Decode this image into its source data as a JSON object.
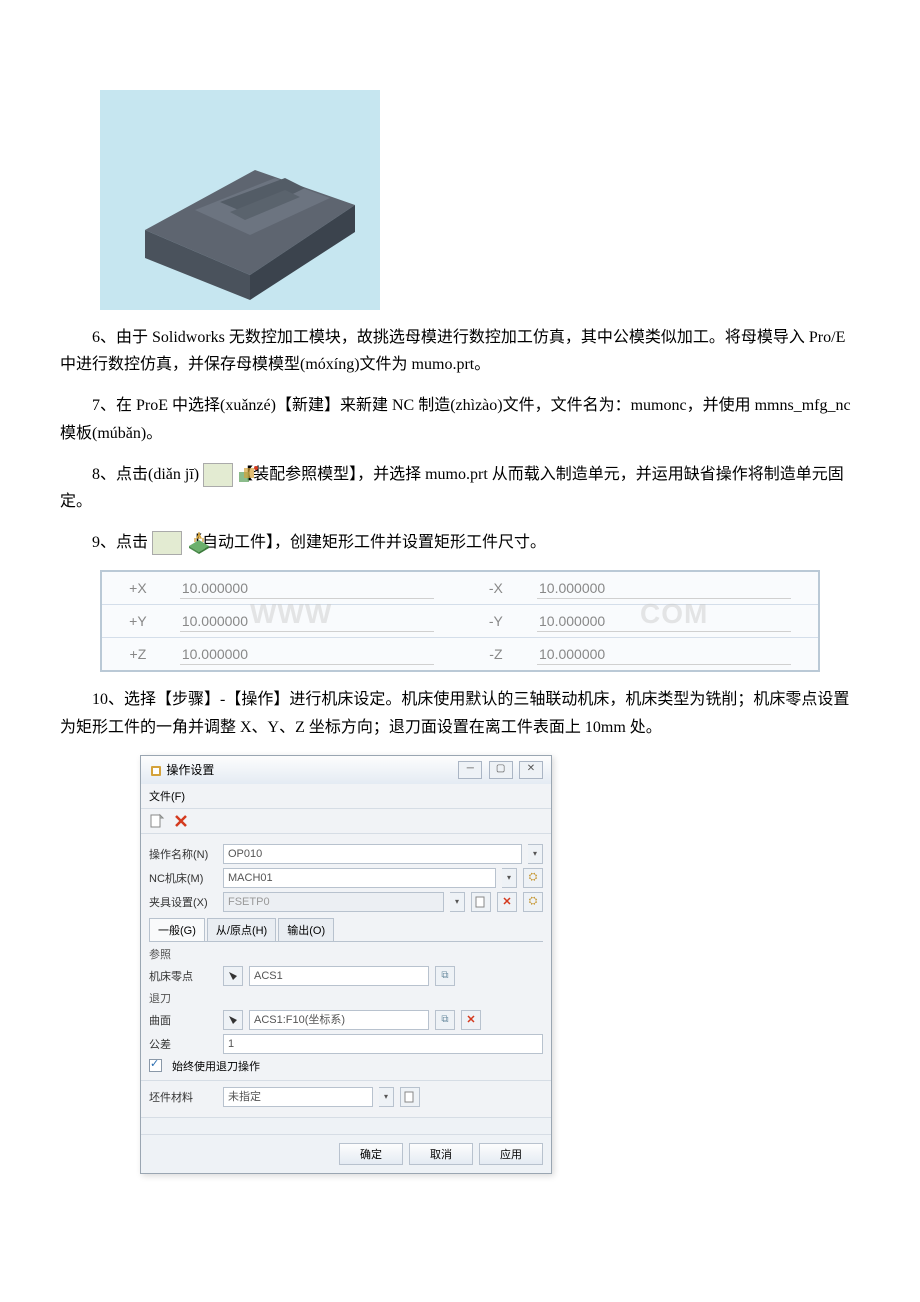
{
  "paragraphs": {
    "p6": "6、由于 Solidworks 无数控加工模块，故挑选母模进行数控加工仿真，其中公模类似加工。将母模导入 Pro/E 中进行数控仿真，并保存母模模型(móxíng)文件为 mumo.prt。",
    "p7": "7、在 ProE 中选择(xuǎnzé)【新建】来新建 NC 制造(zhìzào)文件，文件名为：mumonc，并使用 mmns_mfg_nc 模板(múbǎn)。",
    "p8a": "8、点击(diǎn jī)",
    "p8b": "【装配参照模型】，并选择 mumo.prt 从而载入制造单元，并运用缺省操作将制造单元固定。",
    "p9a": "9、点击",
    "p9b": "【自动工件】，创建矩形工件并设置矩形工件尺寸。",
    "p10": "10、选择【步骤】-【操作】进行机床设定。机床使用默认的三轴联动机床，机床类型为铣削；机床零点设置为矩形工件的一角并调整 X、Y、Z 坐标方向；退刀面设置在离工件表面上 10mm 处。"
  },
  "coord": {
    "labels": {
      "px": "+X",
      "py": "+Y",
      "pz": "+Z",
      "nx": "-X",
      "ny": "-Y",
      "nz": "-Z"
    },
    "values": {
      "px": "10.000000",
      "py": "10.000000",
      "pz": "10.000000",
      "nx": "10.000000",
      "ny": "10.000000",
      "nz": "10.000000"
    },
    "watermark_left": "WWW",
    "watermark_right": "COM"
  },
  "dialog": {
    "title_icon": "操作设置",
    "title": "操作设置",
    "menu_file": "文件(F)",
    "op_name_label": "操作名称(N)",
    "op_name_value": "OP010",
    "nc_machine_label": "NC机床(M)",
    "nc_machine_value": "MACH01",
    "fixture_label": "夹具设置(X)",
    "fixture_value": "FSETP0",
    "tabs": {
      "general": "一般(G)",
      "from": "从/原点(H)",
      "output": "输出(O)"
    },
    "group_ref": "参照",
    "zero_label": "机床零点",
    "zero_value": "ACS1",
    "group_retract": "退刀",
    "surface_label": "曲面",
    "surface_value": "ACS1:F10(坐标系)",
    "tol_label": "公差",
    "tol_value": "1",
    "always_retract": "始终使用退刀操作",
    "stock_label": "坯件材料",
    "stock_value": "未指定",
    "buttons": {
      "ok": "确定",
      "cancel": "取消",
      "apply": "应用"
    }
  }
}
